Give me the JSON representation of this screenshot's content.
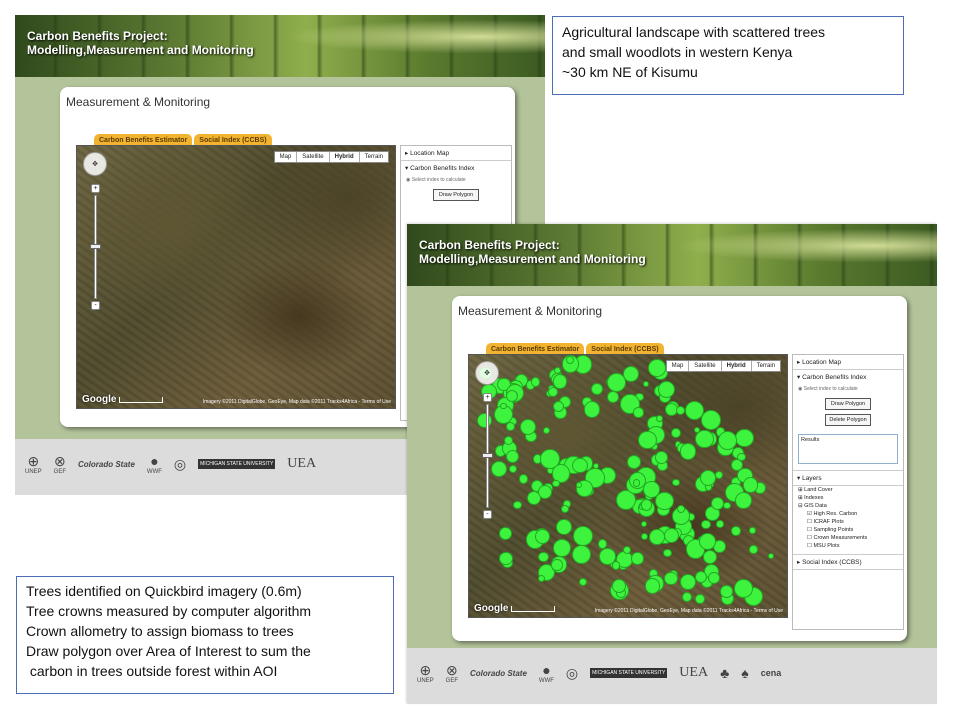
{
  "banner": {
    "line1": "Carbon Benefits Project:",
    "line2": "Modelling,Measurement and Monitoring"
  },
  "card": {
    "title": "Measurement & Monitoring"
  },
  "tabs": [
    "Carbon Benefits Estimator",
    "Social Index (CCBS)"
  ],
  "map": {
    "types": [
      "Map",
      "Satellite",
      "Hybrid",
      "Terrain"
    ],
    "selected_type": "Hybrid",
    "zoom_plus": "+",
    "zoom_minus": "-",
    "google": "Google",
    "terms": "Imagery ©2011 DigitalGlobe, GeoEye, Map data ©2011 Tracks4Africa - Terms of Use"
  },
  "sidebar": {
    "location_map": "Location Map",
    "cbi": "Carbon Benefits Index",
    "select_hint": "Select index to calculate",
    "draw_polygon": "Draw Polygon",
    "delete_polygon": "Delete Polygon",
    "results": "Results",
    "layers": "Layers",
    "land_cover": "Land Cover",
    "indexes": "Indexes",
    "gis_data": "GIS Data",
    "gis_items": [
      "High Res. Carbon",
      "ICRAF Plots",
      "Sampling Points",
      "Crown Measurements",
      "MSU Plots"
    ],
    "social_index": "Social Index (CCBS)"
  },
  "footer": {
    "logos": [
      "UNEP",
      "GEF",
      "Colorado State",
      "WWF",
      "",
      "MICHIGAN STATE UNIVERSITY",
      "UEA",
      "",
      "",
      "cena"
    ]
  },
  "notes": {
    "top": [
      "Agricultural landscape with scattered trees",
      "and small woodlots in western Kenya",
      "~30 km NE of Kisumu"
    ],
    "bottom": [
      "Trees identified on Quickbird imagery (0.6m)",
      "Tree crowns measured by computer algorithm",
      "Crown allometry to assign biomass to trees",
      "Draw polygon over Area of Interest to sum the",
      " carbon in trees outside forest within AOI"
    ]
  },
  "colors": {
    "tab": "#f2b430",
    "tree_crown": "#3ef33e",
    "note_border": "#4a6db5",
    "page_bg": "#b3c49b"
  }
}
